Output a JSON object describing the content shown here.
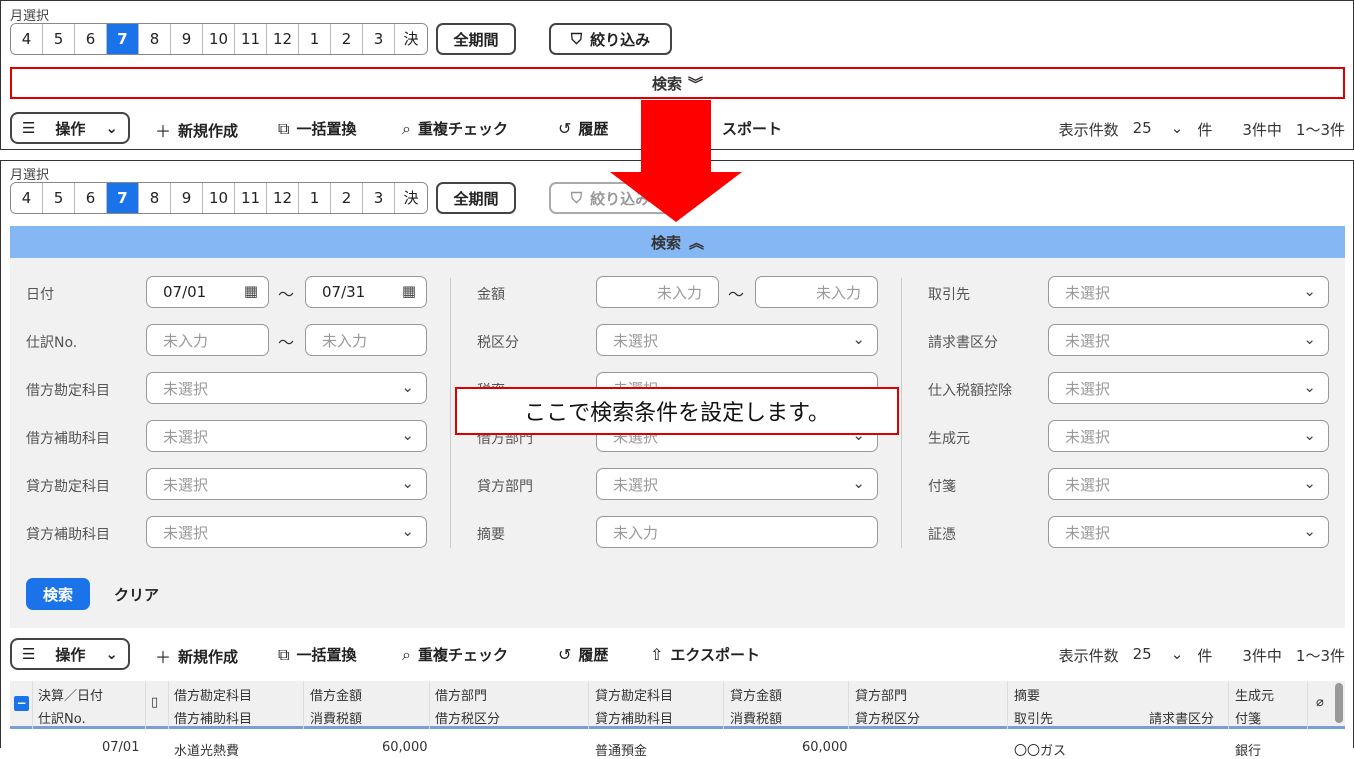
{
  "month_label": "月選択",
  "months": [
    "4",
    "5",
    "6",
    "7",
    "8",
    "9",
    "10",
    "11",
    "12",
    "1",
    "2",
    "3",
    "決"
  ],
  "active_month": "7",
  "all_period": "全期間",
  "filter": "絞り込み",
  "search_label": "検索",
  "toolbar": {
    "operation": "操作",
    "new": "新規作成",
    "bulk_replace": "一括置換",
    "dup_check": "重複チェック",
    "history": "履歴",
    "export": "エクスポート",
    "export_partial": "スポート",
    "display_count_label": "表示件数",
    "display_count": "25",
    "unit": "件",
    "total": "3件中",
    "range": "1〜3件"
  },
  "form": {
    "date_label": "日付",
    "date_from": "07/01",
    "date_to": "07/31",
    "journal_no_label": "仕訳No.",
    "placeholder": "未入力",
    "unselected": "未選択",
    "debit_account_label": "借方勘定科目",
    "debit_sub_label": "借方補助科目",
    "credit_account_label": "貸方勘定科目",
    "credit_sub_label": "貸方補助科目",
    "amount_label": "金額",
    "tax_class_label": "税区分",
    "tax_rate_label": "税率",
    "debit_dept_label": "借方部門",
    "credit_dept_label": "貸方部門",
    "summary_label": "摘要",
    "partner_label": "取引先",
    "invoice_class_label": "請求書区分",
    "purchase_tax_label": "仕入税額控除",
    "source_label": "生成元",
    "tag_label": "付箋",
    "voucher_label": "証憑",
    "search_button": "検索",
    "clear_button": "クリア"
  },
  "callout": "ここで検索条件を設定します。",
  "table": {
    "headers_top": [
      "決算／日付",
      "借方勘定科目",
      "借方金額",
      "借方部門",
      "貸方勘定科目",
      "貸方金額",
      "貸方部門",
      "摘要",
      "生成元"
    ],
    "headers_bottom": [
      "仕訳No.",
      "借方補助科目",
      "消費税額",
      "借方税区分",
      "貸方補助科目",
      "消費税額",
      "貸方税区分",
      "取引先",
      "請求書区分",
      "付箋"
    ],
    "row": {
      "date": "07/01",
      "debit_account": "水道光熱費",
      "debit_amount": "60,000",
      "credit_account": "普通預金",
      "credit_amount": "60,000",
      "partner": "〇〇ガス",
      "source": "銀行"
    }
  },
  "colors": {
    "accent": "#1a73e8",
    "search_bar": "#86b7f5",
    "callout_border": "#dd0000",
    "arrow": "#ff0000"
  }
}
